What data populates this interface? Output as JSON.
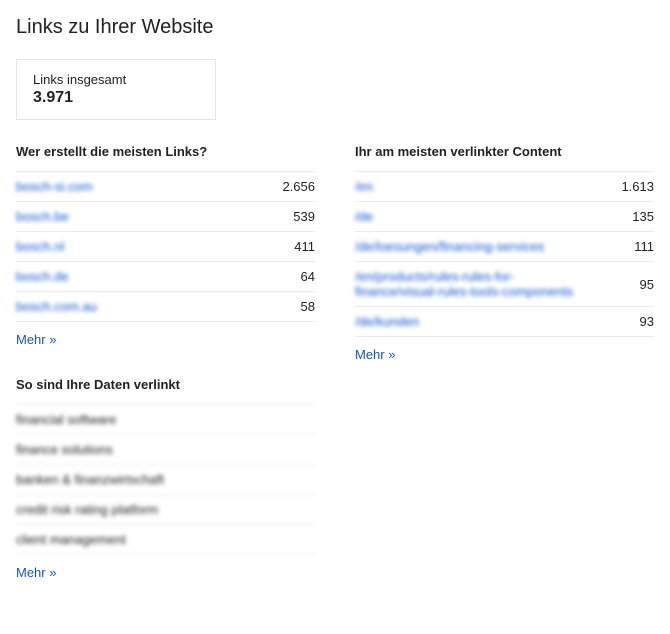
{
  "title": "Links zu Ihrer Website",
  "total": {
    "label": "Links insgesamt",
    "value": "3.971"
  },
  "linkers": {
    "heading": "Wer erstellt die meisten Links?",
    "rows": [
      {
        "label": "bosch-si.com",
        "value": "2.656"
      },
      {
        "label": "bosch.be",
        "value": "539"
      },
      {
        "label": "bosch.nl",
        "value": "411"
      },
      {
        "label": "bosch.de",
        "value": "64"
      },
      {
        "label": "bosch.com.au",
        "value": "58"
      }
    ],
    "more": "Mehr »"
  },
  "content": {
    "heading": "Ihr am meisten verlinkter Content",
    "rows": [
      {
        "label": "/en",
        "value": "1.613"
      },
      {
        "label": "/de",
        "value": "135"
      },
      {
        "label": "/de/loesungen/financing-services",
        "value": "111"
      },
      {
        "label": "/en/products/rules-rules-for-finance/visual-rules-tools-components",
        "value": "95"
      },
      {
        "label": "/de/kunden",
        "value": "93"
      }
    ],
    "more": "Mehr »"
  },
  "anchors": {
    "heading": "So sind Ihre Daten verlinkt",
    "rows": [
      "financial software",
      "finance solutions",
      "banken & finanzwirtschaft",
      "credit risk rating platform",
      "client management"
    ],
    "more": "Mehr »"
  }
}
